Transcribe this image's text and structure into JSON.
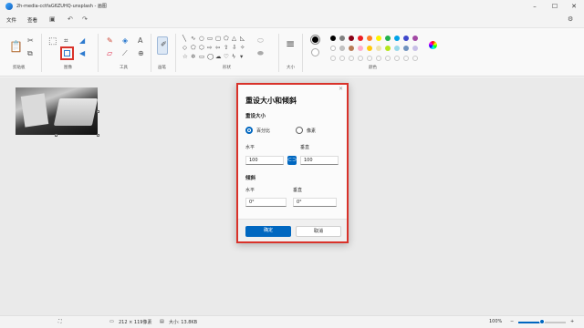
{
  "window": {
    "title": "2h-media-cctfaG6ZUHQ-unsplash - 画图"
  },
  "menu": {
    "file": "文件",
    "view": "查看"
  },
  "ribbon": {
    "groups": {
      "clipboard": "剪贴板",
      "image": "图像",
      "tools": "工具",
      "brushes": "画笔",
      "shapes": "形状",
      "size": "大小",
      "colors": "颜色"
    },
    "colors": {
      "primary": "#000000",
      "secondary": "#ffffff",
      "palette_row1": [
        "#000000",
        "#7f7f7f",
        "#880015",
        "#ed1c24",
        "#ff7f27",
        "#fff200",
        "#22b14c",
        "#00a2e8",
        "#3f48cc",
        "#a349a4"
      ],
      "palette_row2": [
        "#ffffff",
        "#c3c3c3",
        "#b97a57",
        "#ffaec9",
        "#ffc90e",
        "#efe4b0",
        "#b5e61d",
        "#99d9ea",
        "#7092be",
        "#c8bfe7"
      ]
    }
  },
  "dialog": {
    "title": "重设大小和倾斜",
    "resize_section": "重设大小",
    "percent_label": "百分比",
    "pixels_label": "像素",
    "horizontal_label": "水平",
    "vertical_label": "垂直",
    "h_value": "100",
    "v_value": "100",
    "skew_section": "倾斜",
    "skew_h_label": "水平",
    "skew_v_label": "垂直",
    "skew_h_value": "0°",
    "skew_v_value": "0°",
    "ok": "确定",
    "cancel": "取消"
  },
  "status": {
    "dimensions": "212 × 119像素",
    "size": "大小: 13.8KB",
    "zoom": "100%",
    "zoom_fraction": 0.5
  }
}
